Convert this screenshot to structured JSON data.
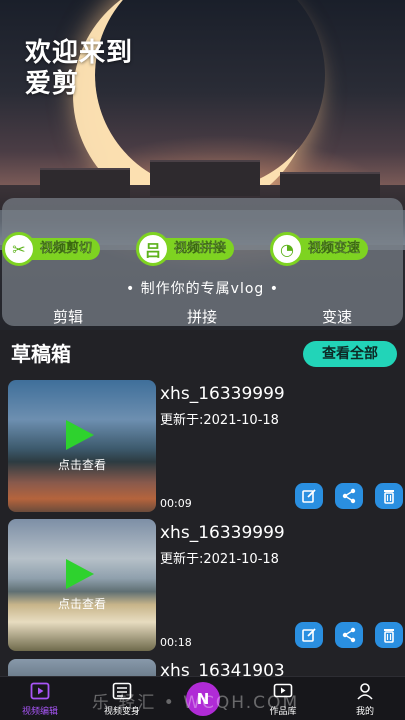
{
  "hero": {
    "welcome": "欢迎来到\n爱剪",
    "tools": [
      {
        "label": "视频剪切",
        "icon": "scissors-icon",
        "glyph": "✂"
      },
      {
        "label": "视频拼接",
        "icon": "merge-icon",
        "glyph": "吕"
      },
      {
        "label": "视频变速",
        "icon": "speed-icon",
        "glyph": "◔"
      }
    ],
    "tagline": "• 制作你的专属vlog •",
    "tabs": [
      "剪辑",
      "拼接",
      "变速"
    ]
  },
  "drafts": {
    "title": "草稿箱",
    "view_all": "查看全部",
    "items": [
      {
        "name": "xhs_16339999",
        "updated": "更新于:2021-10-18",
        "tap": "点击查看",
        "duration": "00:09"
      },
      {
        "name": "xhs_16339999",
        "updated": "更新于:2021-10-18",
        "tap": "点击查看",
        "duration": "00:18"
      },
      {
        "name": "xhs_16341903"
      }
    ]
  },
  "nav": {
    "items": [
      {
        "label": "视频编辑",
        "icon": "video-edit-icon",
        "active": true
      },
      {
        "label": "视频变身",
        "icon": "video-transform-icon"
      },
      {
        "label": "作品库",
        "icon": "library-icon"
      },
      {
        "label": "我的",
        "icon": "profile-icon"
      }
    ],
    "center": "N"
  },
  "watermark": "乐  轻汇  •  WCQH.COM",
  "colors": {
    "accent_green": "#7ed321",
    "view_all_bg": "#22d4b8",
    "action_blue": "#2a8fe0",
    "active_purple": "#a855f7"
  }
}
